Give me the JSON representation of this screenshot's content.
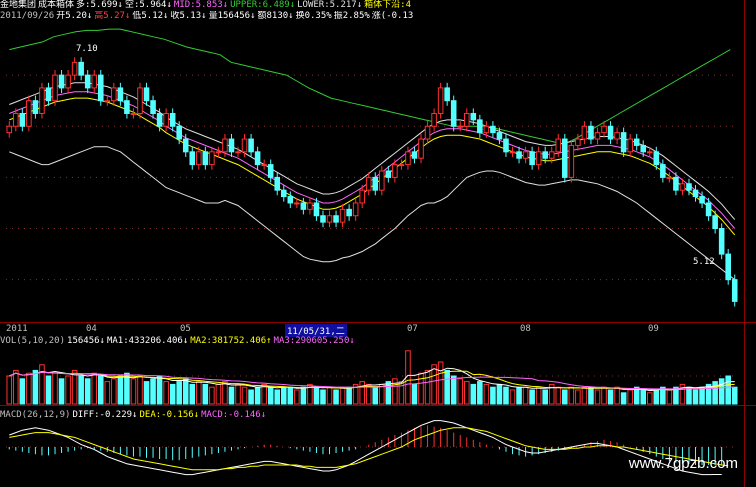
{
  "header": {
    "line1": [
      {
        "text": "金地集团",
        "color": "#ffffff"
      },
      {
        "text": "成本箱体",
        "color": "#ffffff"
      },
      {
        "text": "多:5.699↓",
        "color": "#ffffff"
      },
      {
        "text": "空:5.964↓",
        "color": "#ffffff"
      },
      {
        "text": "MID:5.853↓",
        "color": "#ff66ff"
      },
      {
        "text": "UPPER:6.489↓",
        "color": "#33cc33"
      },
      {
        "text": "LOWER:5.217↓",
        "color": "#e0e0e0"
      },
      {
        "text": "箱体下沿:4",
        "color": "#ffff00"
      }
    ],
    "line2": [
      {
        "text": "2011/09/26",
        "color": "#c0c0c0"
      },
      {
        "text": "开5.20↓",
        "color": "#ffffff"
      },
      {
        "text": "高5.27↓",
        "color": "#ff4040"
      },
      {
        "text": "低5.12↓",
        "color": "#ffffff"
      },
      {
        "text": "收5.13↓",
        "color": "#ffffff"
      },
      {
        "text": "量156456↓",
        "color": "#ffffff"
      },
      {
        "text": "额8130↓",
        "color": "#ffffff"
      },
      {
        "text": "换0.35%",
        "color": "#ffffff"
      },
      {
        "text": "振2.85%",
        "color": "#ffffff"
      },
      {
        "text": "涨(-0.13",
        "color": "#ffffff"
      }
    ]
  },
  "price_labels": {
    "high": "7.10",
    "low": "5.12"
  },
  "date_axis": {
    "labels": [
      "2011",
      "04",
      "05",
      "07",
      "08",
      "09"
    ],
    "selected": "11/05/31,二"
  },
  "vol_header": [
    {
      "text": "VOL(5,10,20)",
      "color": "#c0c0c0"
    },
    {
      "text": "156456↓",
      "color": "#ffffff"
    },
    {
      "text": "MA1:433206.406↓",
      "color": "#ffffff"
    },
    {
      "text": "MA2:381752.406↑",
      "color": "#ffff00"
    },
    {
      "text": "MA3:290605.250↓",
      "color": "#ff66ff"
    }
  ],
  "macd_header": [
    {
      "text": "MACD(26,12,9)",
      "color": "#c0c0c0"
    },
    {
      "text": "DIFF:-0.229↓",
      "color": "#ffffff"
    },
    {
      "text": "DEA:-0.156↓",
      "color": "#ffff00"
    },
    {
      "text": "MACD:-0.146↓",
      "color": "#ff66ff"
    }
  ],
  "watermark": "www.7gpzb.com",
  "colors": {
    "up": "#ff3030",
    "down": "#54ffff",
    "mid": "#ff66ff",
    "upper": "#33cc33",
    "lower": "#e0e0e0",
    "ma": "#ffff00"
  },
  "chart_data": {
    "type": "candlestick",
    "ylim": [
      5.0,
      7.3
    ],
    "close": [
      6.5,
      6.6,
      6.5,
      6.7,
      6.6,
      6.8,
      6.7,
      6.9,
      6.8,
      6.9,
      7.0,
      6.9,
      6.8,
      6.9,
      6.7,
      6.7,
      6.8,
      6.7,
      6.6,
      6.6,
      6.8,
      6.7,
      6.6,
      6.5,
      6.6,
      6.5,
      6.4,
      6.3,
      6.2,
      6.3,
      6.2,
      6.3,
      6.3,
      6.4,
      6.3,
      6.3,
      6.4,
      6.3,
      6.2,
      6.2,
      6.1,
      6.0,
      5.95,
      5.9,
      5.9,
      5.85,
      5.9,
      5.8,
      5.75,
      5.8,
      5.75,
      5.85,
      5.8,
      5.9,
      6.0,
      6.1,
      6.0,
      6.15,
      6.1,
      6.2,
      6.2,
      6.3,
      6.25,
      6.4,
      6.5,
      6.6,
      6.8,
      6.7,
      6.5,
      6.5,
      6.6,
      6.55,
      6.45,
      6.5,
      6.45,
      6.4,
      6.3,
      6.3,
      6.25,
      6.3,
      6.2,
      6.3,
      6.25,
      6.3,
      6.4,
      6.1,
      6.35,
      6.4,
      6.5,
      6.4,
      6.45,
      6.5,
      6.4,
      6.45,
      6.3,
      6.4,
      6.35,
      6.3,
      6.3,
      6.2,
      6.1,
      6.1,
      6.0,
      6.05,
      6.0,
      5.95,
      5.9,
      5.8,
      5.7,
      5.5,
      5.3,
      5.13
    ],
    "mid": [
      6.6,
      6.62,
      6.64,
      6.66,
      6.68,
      6.7,
      6.72,
      6.74,
      6.75,
      6.76,
      6.77,
      6.77,
      6.77,
      6.76,
      6.75,
      6.74,
      6.72,
      6.7,
      6.68,
      6.66,
      6.63,
      6.6,
      6.57,
      6.54,
      6.5,
      6.47,
      6.44,
      6.41,
      6.39,
      6.37,
      6.35,
      6.33,
      6.31,
      6.29,
      6.27,
      6.25,
      6.22,
      6.19,
      6.16,
      6.13,
      6.1,
      6.07,
      6.04,
      6.01,
      5.98,
      5.96,
      5.94,
      5.92,
      5.9,
      5.9,
      5.91,
      5.93,
      5.96,
      5.99,
      6.02,
      6.06,
      6.1,
      6.14,
      6.18,
      6.22,
      6.26,
      6.3,
      6.34,
      6.38,
      6.42,
      6.45,
      6.47,
      6.48,
      6.48,
      6.48,
      6.47,
      6.46,
      6.45,
      6.43,
      6.41,
      6.39,
      6.37,
      6.35,
      6.33,
      6.31,
      6.3,
      6.29,
      6.28,
      6.28,
      6.29,
      6.3,
      6.31,
      6.32,
      6.33,
      6.34,
      6.35,
      6.35,
      6.35,
      6.34,
      6.33,
      6.32,
      6.3,
      6.28,
      6.26,
      6.23,
      6.2,
      6.16,
      6.12,
      6.08,
      6.04,
      6.0,
      5.96,
      5.92,
      5.87,
      5.82,
      5.76,
      5.7
    ],
    "upper": [
      7.1,
      7.12,
      7.14,
      7.16,
      7.2,
      7.22,
      7.24,
      7.25,
      7.25,
      7.26,
      7.26,
      7.24,
      7.22,
      7.2,
      7.18,
      7.15,
      7.12,
      7.1,
      7.08,
      7.06,
      7.0,
      6.98,
      6.96,
      6.94,
      6.92,
      6.9,
      6.85,
      6.8,
      6.76,
      6.72,
      6.7,
      6.68,
      6.66,
      6.64,
      6.62,
      6.6,
      6.58,
      6.56,
      6.54,
      6.52,
      6.5,
      6.5,
      6.5,
      6.5,
      6.48,
      6.46,
      6.44,
      6.42,
      6.4,
      6.38,
      6.36,
      6.4,
      6.45,
      6.5,
      6.55,
      6.6,
      6.65,
      6.7,
      6.75,
      6.8,
      6.85,
      6.9,
      6.95,
      7.0,
      7.05,
      7.1
    ],
    "lower": [
      6.3,
      6.28,
      6.26,
      6.24,
      6.22,
      6.2,
      6.2,
      6.22,
      6.24,
      6.26,
      6.28,
      6.3,
      6.32,
      6.34,
      6.34,
      6.34,
      6.32,
      6.3,
      6.26,
      6.22,
      6.18,
      6.14,
      6.1,
      6.06,
      6.02,
      6.0,
      5.98,
      5.96,
      5.94,
      5.92,
      5.9,
      5.9,
      5.9,
      5.92,
      5.9,
      5.88,
      5.84,
      5.8,
      5.76,
      5.72,
      5.68,
      5.64,
      5.6,
      5.56,
      5.52,
      5.48,
      5.46,
      5.45,
      5.44,
      5.44,
      5.45,
      5.47,
      5.48,
      5.5,
      5.52,
      5.55,
      5.58,
      5.62,
      5.66,
      5.7,
      5.75,
      5.8,
      5.84,
      5.88,
      5.9,
      5.9,
      5.92,
      5.95,
      6.0,
      6.05,
      6.1,
      6.12,
      6.14,
      6.15,
      6.15,
      6.14,
      6.12,
      6.1,
      6.08,
      6.06,
      6.05,
      6.04,
      6.04,
      6.05,
      6.06,
      6.07,
      6.08,
      6.08,
      6.07,
      6.06,
      6.05,
      6.03,
      6.01,
      5.99,
      5.96,
      5.93,
      5.9,
      5.86,
      5.82,
      5.78,
      5.74,
      5.7,
      5.66,
      5.62,
      5.58,
      5.54,
      5.5,
      5.46,
      5.42,
      5.38,
      5.34,
      5.3
    ],
    "volume": [
      0.5,
      0.6,
      0.45,
      0.55,
      0.6,
      0.7,
      0.5,
      0.55,
      0.45,
      0.5,
      0.6,
      0.5,
      0.45,
      0.55,
      0.5,
      0.4,
      0.45,
      0.5,
      0.55,
      0.45,
      0.5,
      0.4,
      0.45,
      0.5,
      0.4,
      0.35,
      0.4,
      0.45,
      0.35,
      0.4,
      0.35,
      0.3,
      0.35,
      0.4,
      0.3,
      0.35,
      0.3,
      0.25,
      0.3,
      0.35,
      0.3,
      0.25,
      0.3,
      0.3,
      0.25,
      0.3,
      0.35,
      0.3,
      0.25,
      0.3,
      0.25,
      0.3,
      0.3,
      0.35,
      0.4,
      0.35,
      0.3,
      0.35,
      0.4,
      0.45,
      0.4,
      0.95,
      0.35,
      0.55,
      0.6,
      0.7,
      0.75,
      0.6,
      0.5,
      0.45,
      0.4,
      0.35,
      0.4,
      0.35,
      0.3,
      0.35,
      0.3,
      0.25,
      0.3,
      0.3,
      0.25,
      0.3,
      0.25,
      0.35,
      0.3,
      0.25,
      0.3,
      0.25,
      0.3,
      0.3,
      0.25,
      0.3,
      0.25,
      0.3,
      0.2,
      0.25,
      0.3,
      0.25,
      0.2,
      0.25,
      0.3,
      0.25,
      0.3,
      0.35,
      0.3,
      0.25,
      0.3,
      0.35,
      0.4,
      0.45,
      0.5,
      0.3
    ],
    "macd": [
      -0.02,
      -0.03,
      -0.04,
      -0.05,
      -0.06,
      -0.07,
      -0.07,
      -0.06,
      -0.05,
      -0.04,
      -0.03,
      -0.02,
      -0.01,
      -0.02,
      -0.03,
      -0.04,
      -0.05,
      -0.06,
      -0.07,
      -0.08,
      -0.08,
      -0.09,
      -0.09,
      -0.1,
      -0.1,
      -0.11,
      -0.11,
      -0.1,
      -0.09,
      -0.08,
      -0.07,
      -0.06,
      -0.05,
      -0.04,
      -0.03,
      -0.02,
      -0.01,
      0,
      0.01,
      0.02,
      0.02,
      0.01,
      0,
      -0.01,
      -0.02,
      -0.03,
      -0.04,
      -0.05,
      -0.06,
      -0.06,
      -0.05,
      -0.04,
      -0.03,
      -0.02,
      0,
      0.02,
      0.04,
      0.06,
      0.08,
      0.1,
      0.12,
      0.14,
      0.16,
      0.17,
      0.18,
      0.17,
      0.16,
      0.14,
      0.12,
      0.1,
      0.08,
      0.06,
      0.04,
      0.02,
      0,
      -0.02,
      -0.04,
      -0.06,
      -0.07,
      -0.08,
      -0.07,
      -0.06,
      -0.05,
      -0.04,
      -0.03,
      -0.02,
      -0.01,
      0,
      0.02,
      0.04,
      0.05,
      0.06,
      0.05,
      0.04,
      0.02,
      0,
      -0.02,
      -0.04,
      -0.06,
      -0.08,
      -0.1,
      -0.12,
      -0.13,
      -0.14,
      -0.14,
      -0.15,
      -0.15,
      -0.15,
      -0.15,
      -0.146
    ],
    "diff": [
      0.1,
      0.12,
      0.14,
      0.15,
      0.16,
      0.15,
      0.14,
      0.12,
      0.1,
      0.08,
      0.05,
      0.02,
      0,
      -0.02,
      -0.05,
      -0.08,
      -0.1,
      -0.12,
      -0.14,
      -0.15,
      -0.16,
      -0.17,
      -0.18,
      -0.19,
      -0.2,
      -0.21,
      -0.22,
      -0.23,
      -0.23,
      -0.22,
      -0.21,
      -0.2,
      -0.19,
      -0.18,
      -0.17,
      -0.16,
      -0.15,
      -0.14,
      -0.13,
      -0.12,
      -0.12,
      -0.13,
      -0.14,
      -0.15,
      -0.16,
      -0.17,
      -0.18,
      -0.19,
      -0.2,
      -0.2,
      -0.19,
      -0.17,
      -0.15,
      -0.12,
      -0.09,
      -0.06,
      -0.03,
      0,
      0.03,
      0.06,
      0.09,
      0.12,
      0.15,
      0.18,
      0.2,
      0.22,
      0.22,
      0.21,
      0.2,
      0.18,
      0.16,
      0.14,
      0.12,
      0.1,
      0.08,
      0.05,
      0.02,
      0,
      -0.02,
      -0.04,
      -0.05,
      -0.05,
      -0.04,
      -0.03,
      -0.02,
      -0.01,
      0,
      0.01,
      0.02,
      0.03,
      0.03,
      0.02,
      0.01,
      0,
      -0.02,
      -0.04,
      -0.06,
      -0.08,
      -0.1,
      -0.12,
      -0.14,
      -0.16,
      -0.18,
      -0.2,
      -0.21,
      -0.22,
      -0.23,
      -0.23,
      -0.229,
      -0.229
    ],
    "dea": [
      0.08,
      0.09,
      0.1,
      0.11,
      0.12,
      0.12,
      0.12,
      0.11,
      0.1,
      0.09,
      0.08,
      0.06,
      0.04,
      0.02,
      0,
      -0.02,
      -0.04,
      -0.06,
      -0.08,
      -0.1,
      -0.11,
      -0.12,
      -0.13,
      -0.14,
      -0.15,
      -0.16,
      -0.17,
      -0.18,
      -0.19,
      -0.19,
      -0.19,
      -0.19,
      -0.19,
      -0.18,
      -0.18,
      -0.17,
      -0.17,
      -0.16,
      -0.16,
      -0.15,
      -0.15,
      -0.15,
      -0.15,
      -0.15,
      -0.15,
      -0.16,
      -0.16,
      -0.17,
      -0.17,
      -0.17,
      -0.17,
      -0.16,
      -0.15,
      -0.14,
      -0.12,
      -0.1,
      -0.08,
      -0.06,
      -0.04,
      -0.02,
      0,
      0.03,
      0.06,
      0.08,
      0.1,
      0.12,
      0.14,
      0.15,
      0.16,
      0.16,
      0.16,
      0.15,
      0.14,
      0.13,
      0.11,
      0.09,
      0.07,
      0.05,
      0.03,
      0.01,
      0,
      -0.01,
      -0.02,
      -0.02,
      -0.02,
      -0.02,
      -0.01,
      -0.01,
      0,
      0,
      0.01,
      0.01,
      0.01,
      0,
      0,
      -0.01,
      -0.02,
      -0.03,
      -0.04,
      -0.05,
      -0.06,
      -0.07,
      -0.08,
      -0.09,
      -0.1,
      -0.11,
      -0.12,
      -0.13,
      -0.14,
      -0.15,
      -0.156
    ]
  }
}
